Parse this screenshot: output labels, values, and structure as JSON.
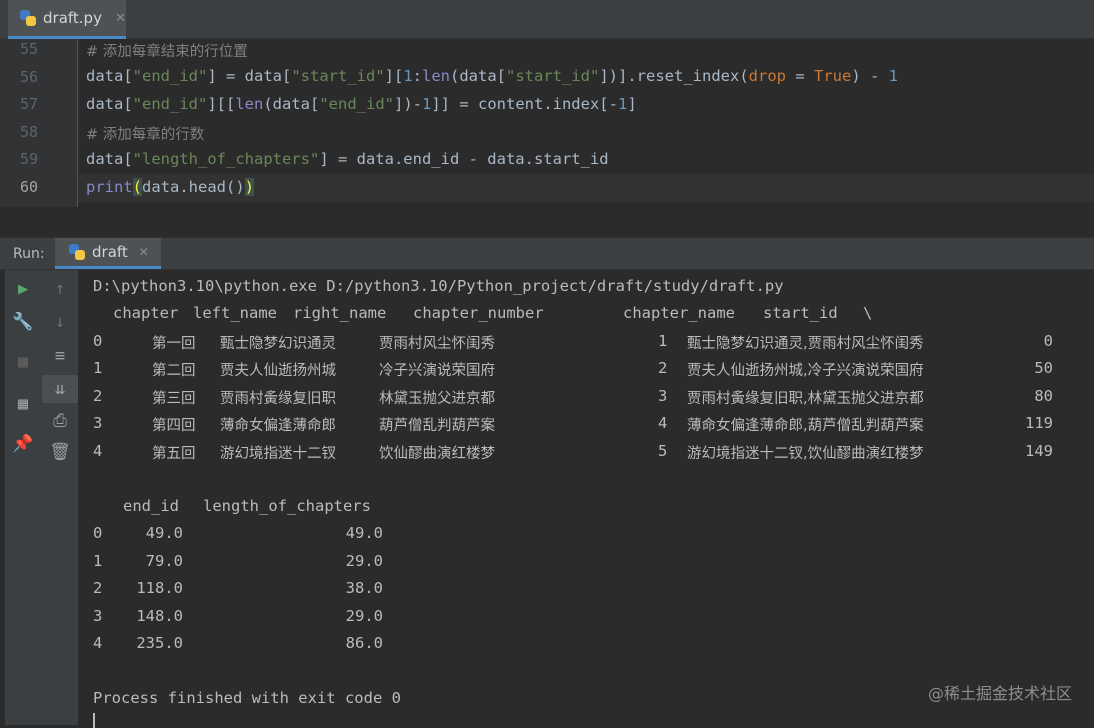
{
  "editor_tab": {
    "filename": "draft.py",
    "close": "✕"
  },
  "editor": {
    "line_numbers": [
      "55",
      "56",
      "57",
      "58",
      "59",
      "60"
    ],
    "comment_55": "# 添加每章结束的行位置",
    "comment_58": "# 添加每章的行数"
  },
  "run_bar": {
    "label": "Run:",
    "config_name": "draft",
    "close": "✕"
  },
  "toolbar": {
    "left": [
      "run-icon",
      "wrench-icon",
      "stop-icon",
      "layout-icon",
      "pin-icon"
    ],
    "right": [
      "up-arrow-icon",
      "down-arrow-icon",
      "soft-wrap-icon",
      "scroll-to-end-icon",
      "print-icon",
      "trash-icon"
    ]
  },
  "console": {
    "command": "D:\\python3.10\\python.exe D:/python3.10/Python_project/draft/study/draft.py",
    "table1_headers": [
      "chapter",
      "left_name",
      "right_name",
      "chapter_number",
      "chapter_name",
      "start_id",
      "\\"
    ],
    "table1_rows": [
      {
        "idx": "0",
        "chapter": "第一回",
        "left": "甄士隐梦幻识通灵",
        "right": "贾雨村风尘怀闺秀",
        "num": "1",
        "name": "甄士隐梦幻识通灵,贾雨村风尘怀闺秀",
        "start": "0"
      },
      {
        "idx": "1",
        "chapter": "第二回",
        "left": "贾夫人仙逝扬州城",
        "right": "冷子兴演说荣国府",
        "num": "2",
        "name": "贾夫人仙逝扬州城,冷子兴演说荣国府",
        "start": "50"
      },
      {
        "idx": "2",
        "chapter": "第三回",
        "left": "贾雨村夤缘复旧职",
        "right": "林黛玉抛父进京都",
        "num": "3",
        "name": "贾雨村夤缘复旧职,林黛玉抛父进京都",
        "start": "80"
      },
      {
        "idx": "3",
        "chapter": "第四回",
        "left": "薄命女偏逢薄命郎",
        "right": "葫芦僧乱判葫芦案",
        "num": "4",
        "name": "薄命女偏逢薄命郎,葫芦僧乱判葫芦案",
        "start": "119"
      },
      {
        "idx": "4",
        "chapter": "第五回",
        "left": "游幻境指迷十二钗",
        "right": "饮仙醪曲演红楼梦",
        "num": "5",
        "name": "游幻境指迷十二钗,饮仙醪曲演红楼梦",
        "start": "149"
      }
    ],
    "table2_headers": [
      "end_id",
      "length_of_chapters"
    ],
    "table2_rows": [
      {
        "idx": "0",
        "end": "49.0",
        "len": "49.0"
      },
      {
        "idx": "1",
        "end": "79.0",
        "len": "29.0"
      },
      {
        "idx": "2",
        "end": "118.0",
        "len": "38.0"
      },
      {
        "idx": "3",
        "end": "148.0",
        "len": "29.0"
      },
      {
        "idx": "4",
        "end": "235.0",
        "len": "86.0"
      }
    ],
    "exit_message": "Process finished with exit code 0"
  },
  "watermark": "@稀土掘金技术社区"
}
